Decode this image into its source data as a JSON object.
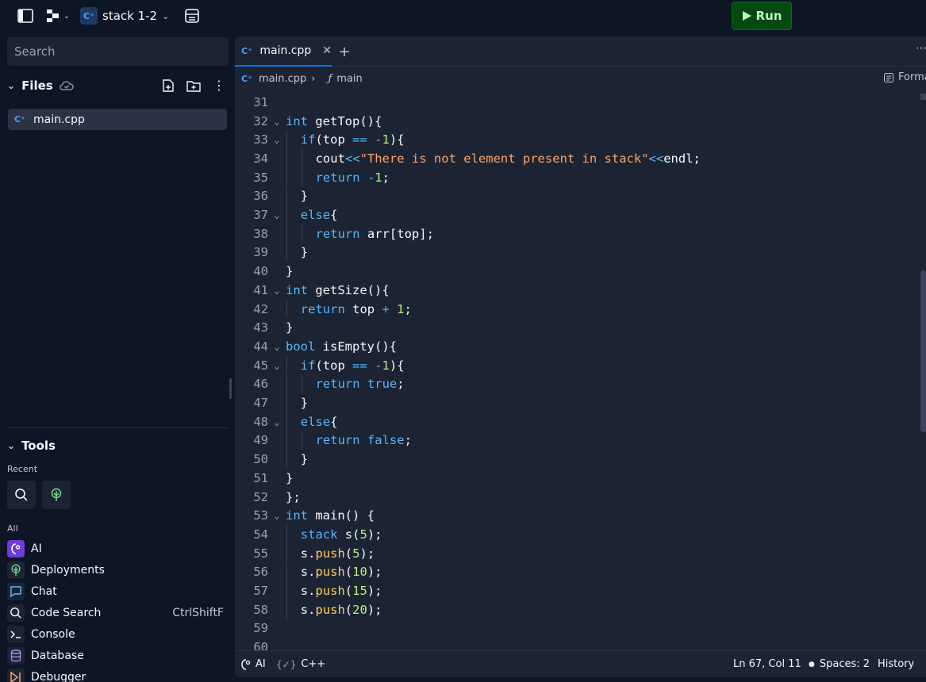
{
  "topbar": {
    "repl_name": "stack 1-2",
    "run_label": "Run",
    "lang_badge": "C++"
  },
  "sidebar": {
    "search_placeholder": "Search",
    "files_title": "Files",
    "files": [
      {
        "name": "main.cpp"
      }
    ],
    "tools_title": "Tools",
    "recent_label": "Recent",
    "all_label": "All",
    "tools": [
      {
        "label": "AI",
        "icon": "ai-icon",
        "color": "#6d3bd8"
      },
      {
        "label": "Deployments",
        "icon": "deployments-icon",
        "color": "#1c2333"
      },
      {
        "label": "Chat",
        "icon": "chat-icon",
        "color": "#1c2333"
      },
      {
        "label": "Code Search",
        "icon": "search-icon",
        "color": "#1c2333",
        "shortcut": "CtrlShiftF"
      },
      {
        "label": "Console",
        "icon": "console-icon",
        "color": "#1c2333"
      },
      {
        "label": "Database",
        "icon": "database-icon",
        "color": "#1c2333"
      },
      {
        "label": "Debugger",
        "icon": "debugger-icon",
        "color": "#1c2333"
      }
    ]
  },
  "editor": {
    "tab_label": "main.cpp",
    "breadcrumb_file": "main.cpp",
    "breadcrumb_symbol": "main",
    "format_label": "Format",
    "lines": [
      {
        "n": "31",
        "fold": false,
        "indent": 0,
        "tokens": []
      },
      {
        "n": "32",
        "fold": true,
        "indent": 0,
        "tokens": [
          [
            "kw",
            "int"
          ],
          [
            "fn",
            " getTop"
          ],
          [
            "pn",
            "(){"
          ]
        ]
      },
      {
        "n": "33",
        "fold": true,
        "indent": 1,
        "tokens": [
          [
            "kw",
            "if"
          ],
          [
            "pn",
            "(top "
          ],
          [
            "kw",
            "=="
          ],
          [
            "pn",
            " "
          ],
          [
            "kw",
            "-"
          ],
          [
            "num",
            "1"
          ],
          [
            "pn",
            "){"
          ]
        ]
      },
      {
        "n": "34",
        "fold": false,
        "indent": 2,
        "tokens": [
          [
            "pn",
            "cout"
          ],
          [
            "kw",
            "<<"
          ],
          [
            "str",
            "\"There is not element present in stack\""
          ],
          [
            "kw",
            "<<"
          ],
          [
            "pn",
            "endl;"
          ]
        ]
      },
      {
        "n": "35",
        "fold": false,
        "indent": 2,
        "tokens": [
          [
            "kw",
            "return"
          ],
          [
            "pn",
            " "
          ],
          [
            "kw",
            "-"
          ],
          [
            "num",
            "1"
          ],
          [
            "pn",
            ";"
          ]
        ]
      },
      {
        "n": "36",
        "fold": false,
        "indent": 1,
        "tokens": [
          [
            "pn",
            "}"
          ]
        ]
      },
      {
        "n": "37",
        "fold": true,
        "indent": 1,
        "tokens": [
          [
            "kw",
            "else"
          ],
          [
            "pn",
            "{"
          ]
        ]
      },
      {
        "n": "38",
        "fold": false,
        "indent": 2,
        "tokens": [
          [
            "kw",
            "return"
          ],
          [
            "pn",
            " arr[top];"
          ]
        ]
      },
      {
        "n": "39",
        "fold": false,
        "indent": 1,
        "tokens": [
          [
            "pn",
            "}"
          ]
        ]
      },
      {
        "n": "40",
        "fold": false,
        "indent": 0,
        "tokens": [
          [
            "pn",
            "}"
          ]
        ]
      },
      {
        "n": "41",
        "fold": true,
        "indent": 0,
        "tokens": [
          [
            "kw",
            "int"
          ],
          [
            "fn",
            " getSize"
          ],
          [
            "pn",
            "(){"
          ]
        ]
      },
      {
        "n": "42",
        "fold": false,
        "indent": 1,
        "tokens": [
          [
            "kw",
            "return"
          ],
          [
            "pn",
            " top "
          ],
          [
            "kw",
            "+"
          ],
          [
            "pn",
            " "
          ],
          [
            "num",
            "1"
          ],
          [
            "pn",
            ";"
          ]
        ]
      },
      {
        "n": "43",
        "fold": false,
        "indent": 0,
        "tokens": [
          [
            "pn",
            "}"
          ]
        ]
      },
      {
        "n": "44",
        "fold": true,
        "indent": 0,
        "tokens": [
          [
            "kw",
            "bool"
          ],
          [
            "fn",
            " isEmpty"
          ],
          [
            "pn",
            "(){"
          ]
        ]
      },
      {
        "n": "45",
        "fold": true,
        "indent": 1,
        "tokens": [
          [
            "kw",
            "if"
          ],
          [
            "pn",
            "(top "
          ],
          [
            "kw",
            "=="
          ],
          [
            "pn",
            " "
          ],
          [
            "kw",
            "-"
          ],
          [
            "num",
            "1"
          ],
          [
            "pn",
            "){"
          ]
        ]
      },
      {
        "n": "46",
        "fold": false,
        "indent": 2,
        "tokens": [
          [
            "kw",
            "return"
          ],
          [
            "pn",
            " "
          ],
          [
            "kw",
            "true"
          ],
          [
            "pn",
            ";"
          ]
        ]
      },
      {
        "n": "47",
        "fold": false,
        "indent": 1,
        "tokens": [
          [
            "pn",
            "}"
          ]
        ]
      },
      {
        "n": "48",
        "fold": true,
        "indent": 1,
        "tokens": [
          [
            "kw",
            "else"
          ],
          [
            "pn",
            "{"
          ]
        ]
      },
      {
        "n": "49",
        "fold": false,
        "indent": 2,
        "tokens": [
          [
            "kw",
            "return"
          ],
          [
            "pn",
            " "
          ],
          [
            "kw",
            "false"
          ],
          [
            "pn",
            ";"
          ]
        ]
      },
      {
        "n": "50",
        "fold": false,
        "indent": 1,
        "tokens": [
          [
            "pn",
            "}"
          ]
        ]
      },
      {
        "n": "51",
        "fold": false,
        "indent": 0,
        "tokens": [
          [
            "pn",
            "}"
          ]
        ]
      },
      {
        "n": "52",
        "fold": false,
        "indent": 0,
        "tokens": [
          [
            "pn",
            "};"
          ]
        ]
      },
      {
        "n": "53",
        "fold": true,
        "indent": 0,
        "tokens": [
          [
            "kw",
            "int"
          ],
          [
            "fn",
            " main"
          ],
          [
            "pn",
            "() {"
          ]
        ]
      },
      {
        "n": "54",
        "fold": false,
        "indent": 1,
        "tokens": [
          [
            "kw",
            "stack"
          ],
          [
            "pn",
            " s("
          ],
          [
            "num",
            "5"
          ],
          [
            "pn",
            ");"
          ]
        ]
      },
      {
        "n": "55",
        "fold": false,
        "indent": 1,
        "tokens": [
          [
            "pn",
            "s."
          ],
          [
            "call",
            "push"
          ],
          [
            "pn",
            "("
          ],
          [
            "num",
            "5"
          ],
          [
            "pn",
            ");"
          ]
        ]
      },
      {
        "n": "56",
        "fold": false,
        "indent": 1,
        "tokens": [
          [
            "pn",
            "s."
          ],
          [
            "call",
            "push"
          ],
          [
            "pn",
            "("
          ],
          [
            "num",
            "10"
          ],
          [
            "pn",
            ");"
          ]
        ]
      },
      {
        "n": "57",
        "fold": false,
        "indent": 1,
        "tokens": [
          [
            "pn",
            "s."
          ],
          [
            "call",
            "push"
          ],
          [
            "pn",
            "("
          ],
          [
            "num",
            "15"
          ],
          [
            "pn",
            ");"
          ]
        ]
      },
      {
        "n": "58",
        "fold": false,
        "indent": 1,
        "tokens": [
          [
            "pn",
            "s."
          ],
          [
            "call",
            "push"
          ],
          [
            "pn",
            "("
          ],
          [
            "num",
            "20"
          ],
          [
            "pn",
            ");"
          ]
        ]
      },
      {
        "n": "59",
        "fold": false,
        "indent": 0,
        "tokens": []
      },
      {
        "n": "60",
        "fold": false,
        "indent": 0,
        "tokens": []
      }
    ]
  },
  "statusbar": {
    "ai_label": "AI",
    "lang_label": "C++",
    "cursor": "Ln 67, Col 11",
    "spaces": "Spaces: 2",
    "history": "History"
  }
}
